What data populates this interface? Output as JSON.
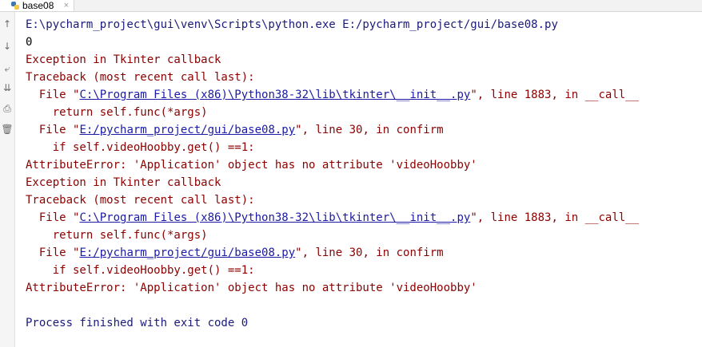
{
  "tab": {
    "title": "base08",
    "close": "×",
    "icon": "python-file-icon"
  },
  "gutter": {
    "buttons": [
      {
        "name": "scroll-up-icon",
        "glyph": "↑"
      },
      {
        "name": "scroll-down-icon",
        "glyph": "↓"
      },
      {
        "name": "soft-wrap-icon",
        "glyph": "⤶"
      },
      {
        "name": "scroll-to-end-icon",
        "glyph": "⇊"
      },
      {
        "name": "print-icon",
        "glyph": "⎙"
      },
      {
        "name": "trash-icon",
        "glyph": "🗑"
      }
    ]
  },
  "output": {
    "command": "E:\\pycharm_project\\gui\\venv\\Scripts\\python.exe E:/pycharm_project/gui/base08.py",
    "stdout0": "0",
    "blocks": [
      {
        "exception": "Exception in Tkinter callback",
        "traceback": "Traceback (most recent call last):",
        "f1_pre": "  File \"",
        "f1_link": "C:\\Program Files (x86)\\Python38-32\\lib\\tkinter\\__init__.py",
        "f1_post": "\", line 1883, in __call__",
        "f1_code": "    return self.func(*args)",
        "f2_pre": "  File \"",
        "f2_link": "E:/pycharm_project/gui/base08.py",
        "f2_post": "\", line 30, in confirm",
        "f2_code": "    if self.videoHoobby.get() ==1:",
        "error": "AttributeError: 'Application' object has no attribute 'videoHoobby'"
      },
      {
        "exception": "Exception in Tkinter callback",
        "traceback": "Traceback (most recent call last):",
        "f1_pre": "  File \"",
        "f1_link": "C:\\Program Files (x86)\\Python38-32\\lib\\tkinter\\__init__.py",
        "f1_post": "\", line 1883, in __call__",
        "f1_code": "    return self.func(*args)",
        "f2_pre": "  File \"",
        "f2_link": "E:/pycharm_project/gui/base08.py",
        "f2_post": "\", line 30, in confirm",
        "f2_code": "    if self.videoHoobby.get() ==1:",
        "error": "AttributeError: 'Application' object has no attribute 'videoHoobby'"
      }
    ],
    "finished": "Process finished with exit code 0"
  }
}
